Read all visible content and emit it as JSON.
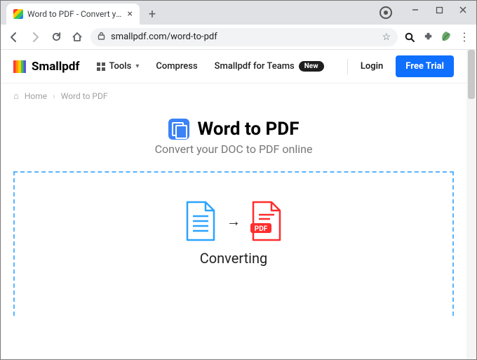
{
  "browser": {
    "tab_title": "Word to PDF - Convert your DOC",
    "url": "smallpdf.com/word-to-pdf"
  },
  "header": {
    "brand": "Smallpdf",
    "nav": {
      "tools": "Tools",
      "compress": "Compress",
      "teams": "Smallpdf for Teams",
      "teams_badge": "New",
      "login": "Login",
      "trial": "Free Trial"
    }
  },
  "breadcrumb": {
    "home": "Home",
    "current": "Word to PDF"
  },
  "hero": {
    "title": "Word to PDF",
    "subtitle": "Convert your DOC to PDF online"
  },
  "convert": {
    "status": "Converting",
    "pdf_label": "PDF"
  }
}
